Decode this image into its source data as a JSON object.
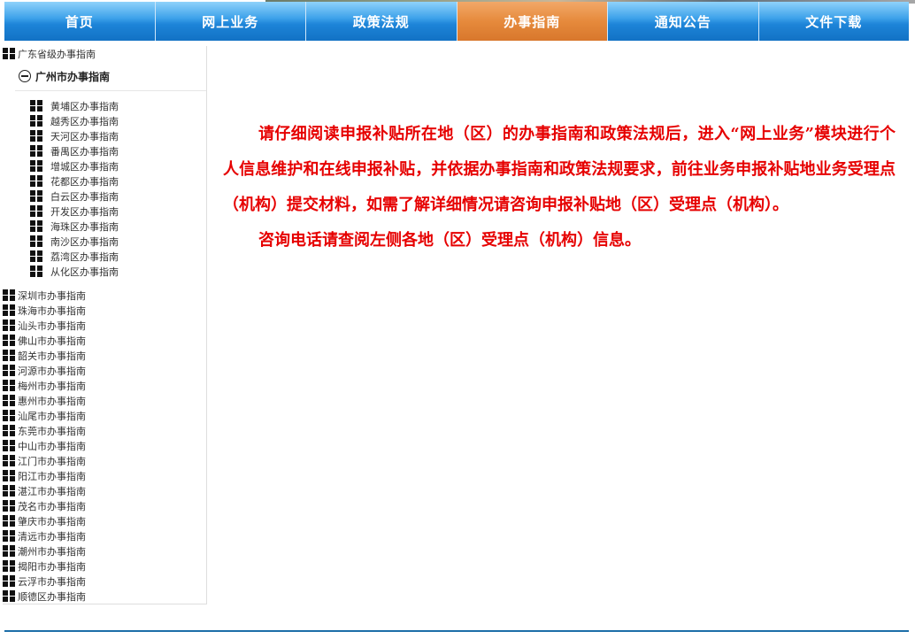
{
  "nav": {
    "items": [
      "首页",
      "网上业务",
      "政策法规",
      "办事指南",
      "通知公告",
      "文件下载"
    ],
    "active_index": 3
  },
  "colors": {
    "nav_blue": "#1d84d8",
    "nav_active": "#e68a3c",
    "content_text": "#e60000"
  },
  "sidebar": {
    "first_item": "广东省级办事指南",
    "open_item": "广州市办事指南",
    "sub_items": [
      "黄埔区办事指南",
      "越秀区办事指南",
      "天河区办事指南",
      "番禺区办事指南",
      "增城区办事指南",
      "花都区办事指南",
      "白云区办事指南",
      "开发区办事指南",
      "海珠区办事指南",
      "南沙区办事指南",
      "荔湾区办事指南",
      "从化区办事指南"
    ],
    "other_items": [
      "深圳市办事指南",
      "珠海市办事指南",
      "汕头市办事指南",
      "佛山市办事指南",
      "韶关市办事指南",
      "河源市办事指南",
      "梅州市办事指南",
      "惠州市办事指南",
      "汕尾市办事指南",
      "东莞市办事指南",
      "中山市办事指南",
      "江门市办事指南",
      "阳江市办事指南",
      "湛江市办事指南",
      "茂名市办事指南",
      "肇庆市办事指南",
      "清远市办事指南",
      "潮州市办事指南",
      "揭阳市办事指南",
      "云浮市办事指南",
      "顺德区办事指南"
    ]
  },
  "content": {
    "paragraph1": "请仔细阅读申报补贴所在地（区）的办事指南和政策法规后，进入“网上业务”模块进行个人信息维护和在线申报补贴，并依据办事指南和政策法规要求，前往业务申报补贴地业务受理点（机构）提交材料，如需了解详细情况请咨询申报补贴地（区）受理点（机构）。",
    "paragraph2": "咨询电话请查阅左侧各地（区）受理点（机构）信息。"
  }
}
